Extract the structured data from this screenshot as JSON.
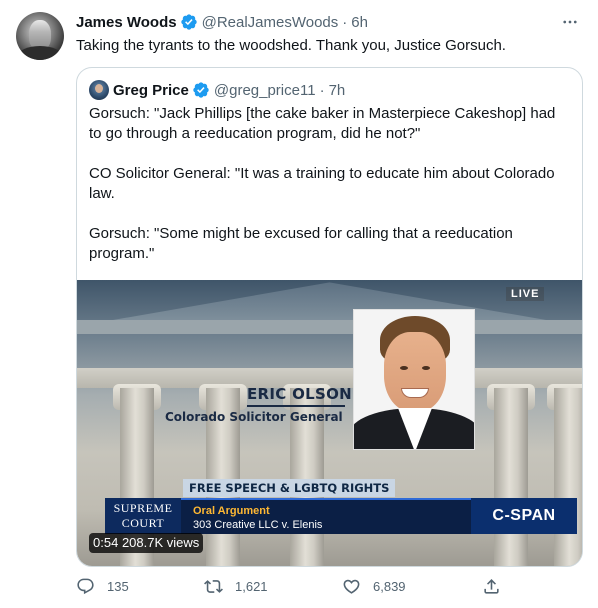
{
  "tweet": {
    "author_name": "James Woods",
    "author_handle": "@RealJamesWoods",
    "timestamp": "6h",
    "separator": "·",
    "text": "Taking the tyrants to the woodshed. Thank you, Justice Gorsuch.",
    "more_icon": "more-horizontal-icon"
  },
  "quote": {
    "author_name": "Greg Price",
    "author_handle": "@greg_price11",
    "timestamp": "7h",
    "separator": "·",
    "paragraphs": [
      "Gorsuch: \"Jack Phillips [the cake baker in Masterpiece Cakeshop] had to go through a reeducation program, did he not?\"",
      "CO Solicitor General: \"It was a training to educate him about Colorado law.",
      "Gorsuch: \"Some might be excused for calling that a reeducation program.\""
    ],
    "video": {
      "live_label": "LIVE",
      "speaker_name": "ERIC OLSON",
      "speaker_title": "Colorado Solicitor General",
      "topic": "FREE SPEECH & LGBTQ RIGHTS",
      "court_line1": "SUPREME",
      "court_line2": "COURT",
      "event_label": "Oral Argument",
      "case_name": "303 Creative LLC v. Elenis",
      "network_logo": "C-SPAN",
      "duration": "0:54",
      "views": "208.7K views"
    }
  },
  "actions": {
    "replies": {
      "icon": "reply-icon",
      "count": "135"
    },
    "retweets": {
      "icon": "retweet-icon",
      "count": "1,621"
    },
    "likes": {
      "icon": "like-icon",
      "count": "6,839"
    },
    "share": {
      "icon": "share-icon"
    }
  },
  "colors": {
    "verified_blue": "#1d9bf0",
    "text_primary": "#0f1419",
    "text_secondary": "#536471",
    "border": "#cfd9de"
  }
}
